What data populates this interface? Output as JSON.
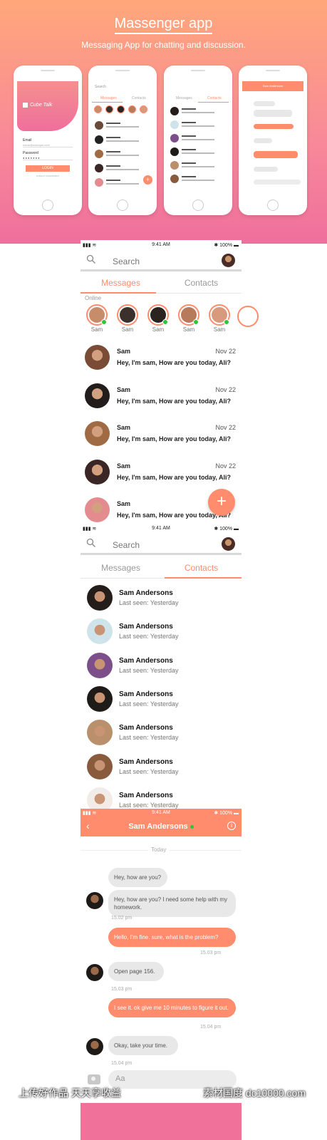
{
  "hero": {
    "title": "Massenger app",
    "subtitle": "Messaging App for chatting and discussion.",
    "login_preview": {
      "brand": "Cube Talk",
      "email_label": "Email",
      "email_value": "name@example.com",
      "password_label": "Password",
      "password_value": "● ● ● ● ● ● ●",
      "login_button": "LOGIN",
      "forgot": "FORGOT PASSWORD?"
    }
  },
  "colors": {
    "accent": "#ff8c6c",
    "online": "#2ec43b",
    "hero_top": "#ffa77a",
    "hero_bottom": "#ef6f9c"
  },
  "status_bar": {
    "time": "9:41 AM",
    "battery": "100%",
    "signal": "▮▮▮ ≋",
    "battery_icon": "▬"
  },
  "search": {
    "placeholder": "Search",
    "icon": "search-icon"
  },
  "tabs": {
    "messages": "Messages",
    "contacts": "Contacts"
  },
  "messages_screen": {
    "online_label": "Online",
    "online": [
      {
        "name": "Sam",
        "face": "#c78d6b",
        "online": true
      },
      {
        "name": "Sam",
        "face": "#3c302c",
        "online": false
      },
      {
        "name": "Sam",
        "face": "#2a2320",
        "online": true
      },
      {
        "name": "Sam",
        "face": "#b77a5a",
        "online": true
      },
      {
        "name": "Sam",
        "face": "#d89a7c",
        "online": true
      }
    ],
    "threads": [
      {
        "name": "Sam",
        "date": "Nov 22",
        "text": "Hey, I'm sam, How are you today, Ali?",
        "face": "#7a4b35"
      },
      {
        "name": "Sam",
        "date": "Nov 22",
        "text": "Hey, I'm sam, How are you today, Ali?",
        "face": "#221c1a"
      },
      {
        "name": "Sam",
        "date": "Nov 22",
        "text": "Hey, I'm sam, How are you today, Ali?",
        "face": "#a06a45"
      },
      {
        "name": "Sam",
        "date": "Nov 22",
        "text": "Hey, I'm sam, How are you today, Ali?",
        "face": "#3a2624"
      },
      {
        "name": "Sam",
        "date": "",
        "text": "Hey, I'm sam, How are you today, Ali?",
        "face": "#e38b8f"
      }
    ],
    "fab": "+"
  },
  "contacts_screen": {
    "contacts": [
      {
        "name": "Sam Andersons",
        "last_seen": "Last seen: Yesterday",
        "face": "#241d1a"
      },
      {
        "name": "Sam Andersons",
        "last_seen": "Last seen: Yesterday",
        "face": "#cfe4ea"
      },
      {
        "name": "Sam Andersons",
        "last_seen": "Last seen: Yesterday",
        "face": "#7d4f8a"
      },
      {
        "name": "Sam Andersons",
        "last_seen": "Last seen: Yesterday",
        "face": "#1f1b19"
      },
      {
        "name": "Sam Andersons",
        "last_seen": "Last seen: Yesterday",
        "face": "#b98f6c"
      },
      {
        "name": "Sam Andersons",
        "last_seen": "Last seen: Yesterday",
        "face": "#8a5a3c"
      },
      {
        "name": "Sam Andersons",
        "last_seen": "Last seen: Yesterday",
        "face": "#f1ece8"
      }
    ]
  },
  "chat_screen": {
    "contact_name": "Sam Andersons",
    "back": "‹",
    "info": "i",
    "day": "Today",
    "messages": [
      {
        "dir": "in",
        "text": "Hey, how are you?"
      },
      {
        "dir": "in",
        "text": "Hey, how are you? I need some help with my homework."
      },
      {
        "stamp": "15.02 pm"
      },
      {
        "dir": "out",
        "text": "Hello, I'm fine. sure, what is the problem?"
      },
      {
        "stamp": "15.03 pm"
      },
      {
        "dir": "in",
        "text": "Open page 156."
      },
      {
        "stamp": "15.03 pm"
      },
      {
        "dir": "out",
        "text": "I see it. ok give me 10 minutes to figure it out."
      },
      {
        "stamp": "15.04 pm"
      },
      {
        "dir": "in",
        "text": "Okay, take your time."
      },
      {
        "stamp": "15.04 pm"
      }
    ],
    "composer_placeholder": "Aa"
  },
  "watermark": {
    "left": "上传好作品 天天享收益",
    "right": "素材国度 dc10000.com"
  }
}
